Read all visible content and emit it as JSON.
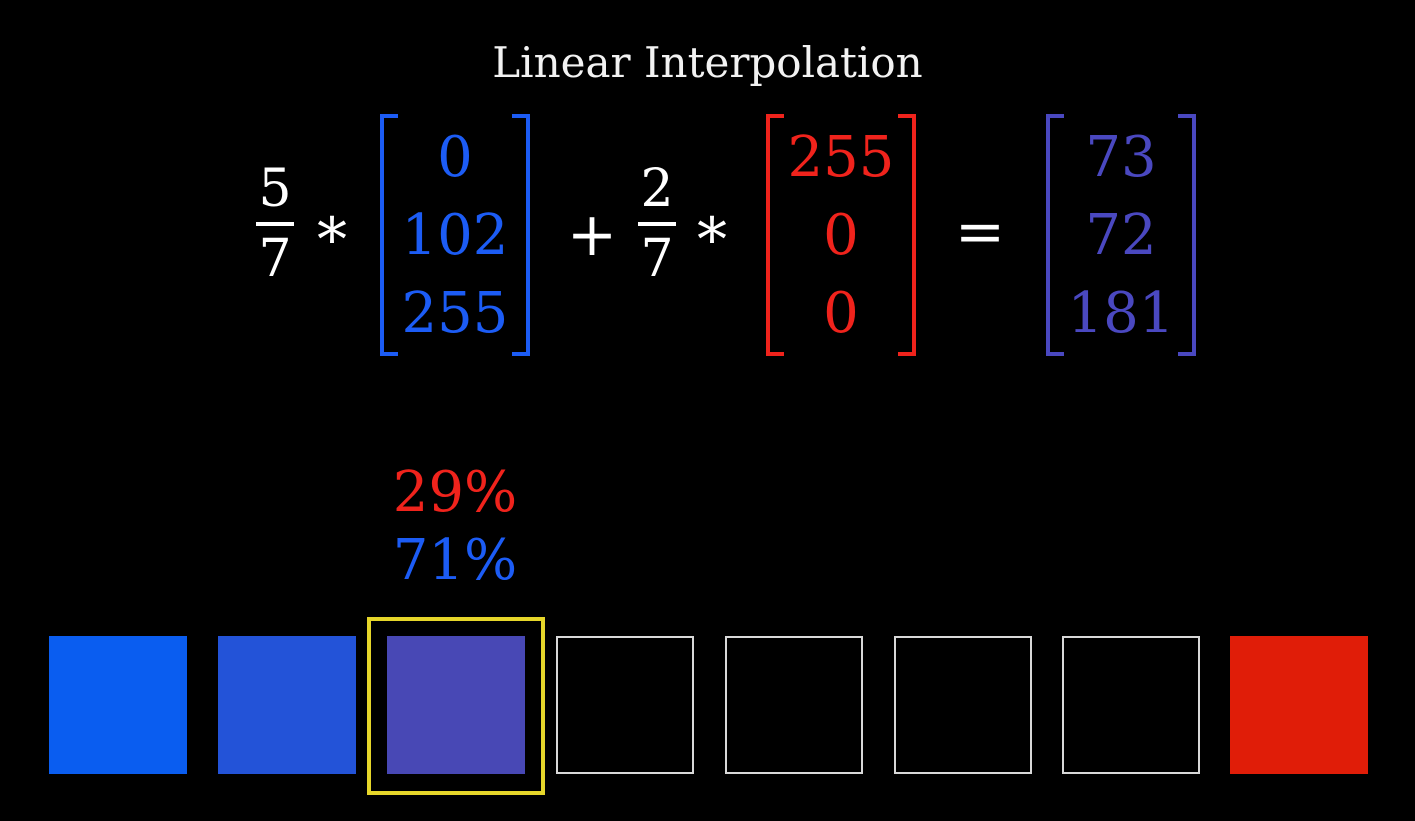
{
  "title": "Linear Interpolation",
  "equation": {
    "term1": {
      "coef_num": "5",
      "coef_den": "7",
      "vector": [
        "0",
        "102",
        "255"
      ],
      "color": "#1c5cf5"
    },
    "op_multiply": "*",
    "op_plus": "+",
    "op_equals": "=",
    "term2": {
      "coef_num": "2",
      "coef_den": "7",
      "vector": [
        "255",
        "0",
        "0"
      ],
      "color": "#f0231c"
    },
    "result": {
      "vector": [
        "73",
        "72",
        "181"
      ],
      "color": "#4a48c0"
    }
  },
  "percentages": {
    "red": "29%",
    "red_color": "#f0231c",
    "blue": "71%",
    "blue_color": "#1c5cf5"
  },
  "swatches": [
    {
      "color": "#0a5df0",
      "filled": true
    },
    {
      "color": "#2353d8",
      "filled": true
    },
    {
      "color": "#4848b5",
      "filled": true,
      "selected": true
    },
    {
      "color": null,
      "filled": false
    },
    {
      "color": null,
      "filled": false
    },
    {
      "color": null,
      "filled": false
    },
    {
      "color": null,
      "filled": false
    },
    {
      "color": "#e01d08",
      "filled": true
    }
  ],
  "highlight_color": "#e6d62a"
}
